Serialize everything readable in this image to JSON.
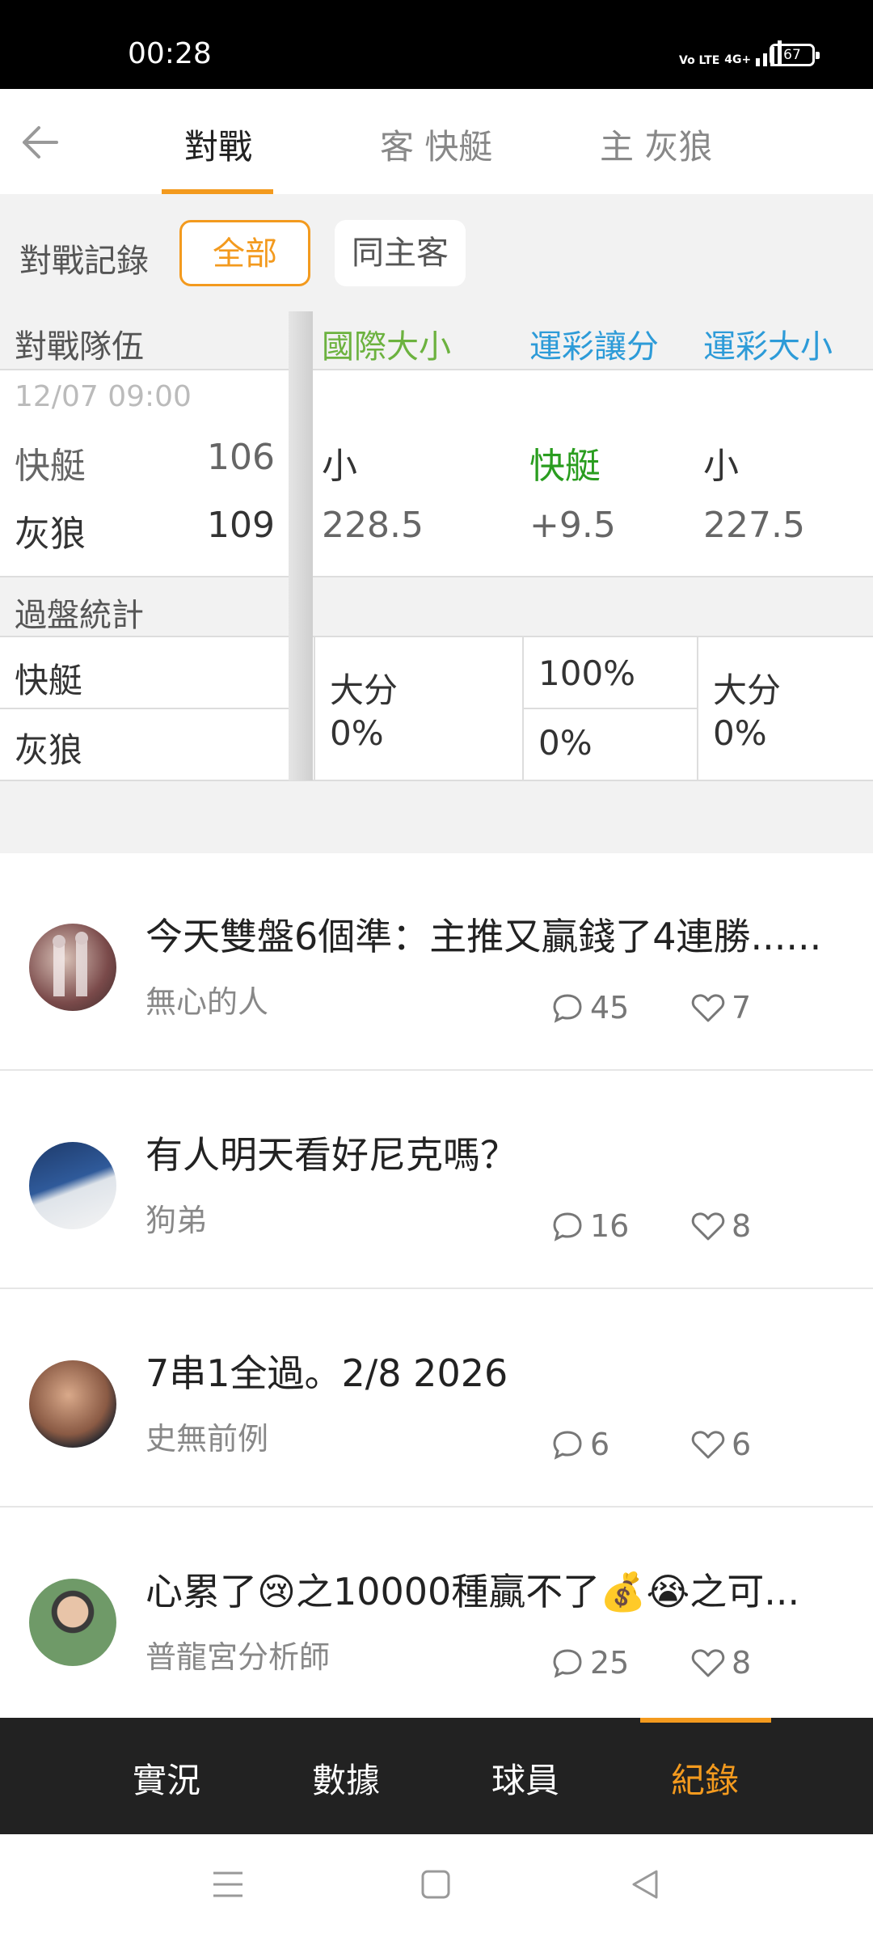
{
  "status_bar": {
    "time": "00:28",
    "network": "4G+",
    "volte": "Vo LTE",
    "battery": "67"
  },
  "nav": {
    "tabs": [
      {
        "label": "對戰"
      },
      {
        "label": "客 快艇"
      },
      {
        "label": "主 灰狼"
      }
    ]
  },
  "filter": {
    "label": "對戰記錄",
    "options": [
      "全部",
      "同主客"
    ],
    "selected": "全部"
  },
  "table": {
    "headers": {
      "team": "對戰隊伍",
      "intl_ou": "國際大小",
      "spread": "運彩讓分",
      "lottery_ou": "運彩大小"
    },
    "match": {
      "date": "12/07 09:00",
      "away": {
        "name": "快艇",
        "score": "106"
      },
      "home": {
        "name": "灰狼",
        "score": "109"
      },
      "intl_ou": {
        "result": "小",
        "line": "228.5"
      },
      "spread": {
        "result": "快艇",
        "line": "+9.5"
      },
      "lottery_ou": {
        "result": "小",
        "line": "227.5"
      }
    },
    "stats": {
      "label": "過盤統計",
      "teams": [
        "快艇",
        "灰狼"
      ],
      "intl_ou": {
        "label": "大分",
        "value": "0%"
      },
      "spread": {
        "away": "100%",
        "home": "0%"
      },
      "lottery_ou": {
        "label": "大分",
        "value": "0%"
      }
    }
  },
  "posts": [
    {
      "title": "今天雙盤6個準：主推又贏錢了4連勝......",
      "author": "無心的人",
      "comments": "45",
      "likes": "7"
    },
    {
      "title": "有人明天看好尼克嗎？",
      "author": "狗弟",
      "comments": "16",
      "likes": "8"
    },
    {
      "title": "7串1全過。2/8  2026",
      "author": "史無前例",
      "comments": "6",
      "likes": "6"
    },
    {
      "title": "心累了😢之10000種贏不了💰😭之可...",
      "author": "普龍宮分析師",
      "comments": "25",
      "likes": "8"
    }
  ],
  "bottom_tabs": [
    {
      "label": "實況"
    },
    {
      "label": "數據"
    },
    {
      "label": "球員"
    },
    {
      "label": "紀錄"
    }
  ],
  "colors": {
    "accent": "#f39a1e",
    "green_header": "#6cb23f",
    "blue_header": "#2d9bd8",
    "team_green": "#2a9d1f"
  }
}
